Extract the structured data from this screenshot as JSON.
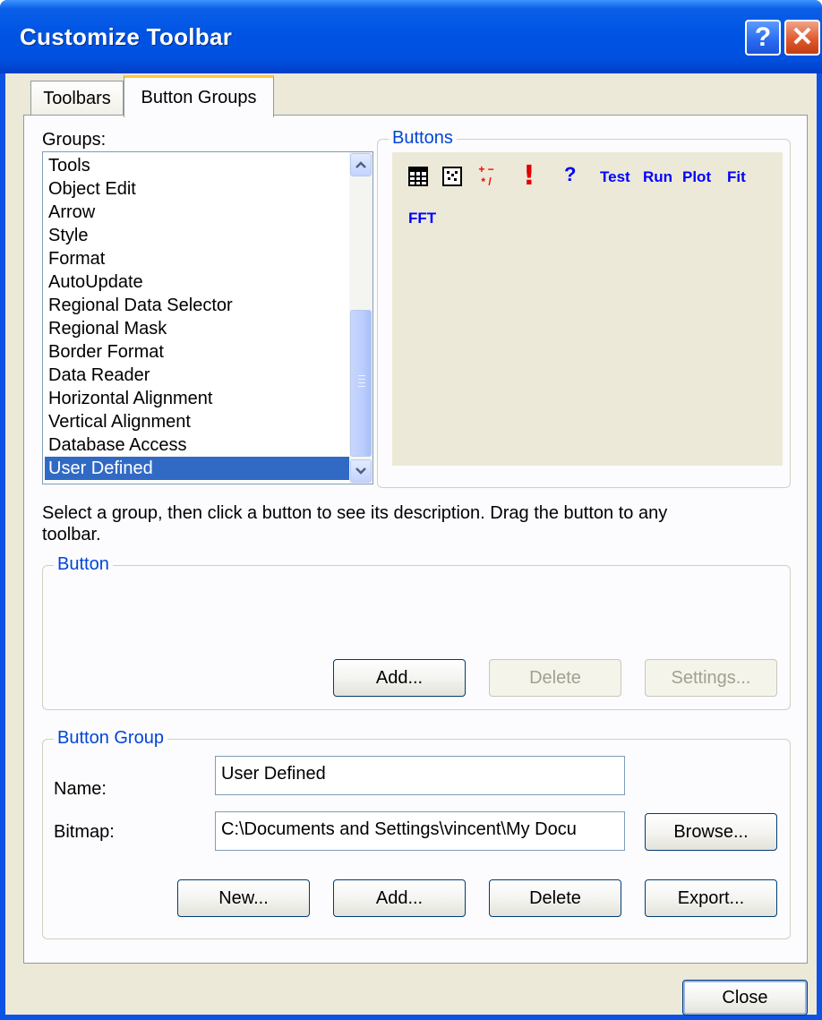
{
  "window": {
    "title": "Customize Toolbar"
  },
  "titlebar": {
    "help_glyph": "?",
    "close_glyph": "✕"
  },
  "tabs": [
    {
      "label": "Toolbars"
    },
    {
      "label": "Button Groups"
    }
  ],
  "groups": {
    "label": "Groups:",
    "items": [
      "Tools",
      "Object Edit",
      "Arrow",
      "Style",
      "Format",
      "AutoUpdate",
      "Regional Data Selector",
      "Regional Mask",
      "Border Format",
      "Data Reader",
      "Horizontal Alignment",
      "Vertical Alignment",
      "Database Access",
      "User Defined"
    ],
    "selected": "User Defined"
  },
  "buttons_panel": {
    "title": "Buttons",
    "icons": [
      {
        "name": "table-grid-icon"
      },
      {
        "name": "dot-matrix-icon"
      },
      {
        "name": "math-ops-icon",
        "text": "+ −\n* /"
      },
      {
        "name": "exclamation-icon",
        "text": "!"
      },
      {
        "name": "help-question-icon",
        "text": "?"
      },
      {
        "name": "test-text-button",
        "text": "Test"
      },
      {
        "name": "run-text-button",
        "text": "Run"
      },
      {
        "name": "plot-text-button",
        "text": "Plot"
      },
      {
        "name": "fit-text-button",
        "text": "Fit"
      },
      {
        "name": "fft-text-button",
        "text": "FFT"
      }
    ]
  },
  "instructions": "Select a group, then click a button to see its description. Drag the button to any toolbar.",
  "button_section": {
    "title": "Button",
    "add_label": "Add...",
    "delete_label": "Delete",
    "settings_label": "Settings..."
  },
  "button_group_section": {
    "title": "Button Group",
    "name_label": "Name:",
    "name_value": "User Defined",
    "bitmap_label": "Bitmap:",
    "bitmap_value": "C:\\Documents and Settings\\vincent\\My Docu",
    "browse_label": "Browse...",
    "new_label": "New...",
    "add_label": "Add...",
    "delete_label": "Delete",
    "export_label": "Export..."
  },
  "footer": {
    "close_label": "Close"
  },
  "colors": {
    "title_blue": "#0054e3",
    "accent_blue": "#0046d5",
    "selection": "#316ac5",
    "face": "#ece9d8",
    "icon_blue": "#0000ff",
    "icon_red": "#ff0000"
  }
}
